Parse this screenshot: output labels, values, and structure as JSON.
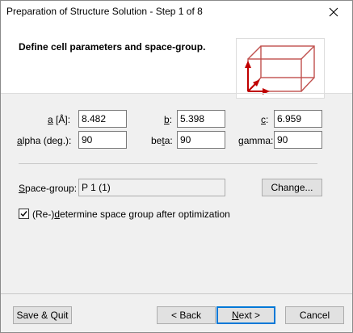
{
  "window": {
    "title": "Preparation of Structure Solution - Step 1 of 8"
  },
  "header": {
    "heading": "Define cell parameters and space-group."
  },
  "cell": {
    "a": {
      "label_key": "a",
      "label_rest": " [Å]:",
      "value": "8.482"
    },
    "b": {
      "label_key": "b",
      "label_rest": ":",
      "value": "5.398"
    },
    "c": {
      "label_key": "c",
      "label_rest": ":",
      "value": "6.959"
    },
    "alpha": {
      "label_key": "a",
      "label_rest": "lpha (deg.):",
      "value": "90"
    },
    "beta": {
      "label_pre": "be",
      "label_key": "t",
      "label_rest": "a:",
      "value": "90"
    },
    "gamma": {
      "label_key": "g",
      "label_rest": "amma:",
      "value": "90"
    }
  },
  "spacegroup": {
    "label_key": "S",
    "label_rest": "pace-group:",
    "value": "P 1 (1)",
    "change_pre": "Chan",
    "change_key": "g",
    "change_rest": "e...",
    "redetermine_pre": "(Re-)",
    "redetermine_key": "d",
    "redetermine_rest": "etermine space group after optimization",
    "redetermine_checked": true
  },
  "buttons": {
    "save_quit": "Save & Quit",
    "back": "< Back",
    "next_pre": "",
    "next_key": "N",
    "next_rest": "ext >",
    "cancel": "Cancel"
  },
  "colors": {
    "cell_box": "#c0504d",
    "cell_arrow": "#c00000",
    "focus": "#0078d7"
  },
  "icons": {
    "close": "close-icon",
    "cell": "unit-cell-icon",
    "check": "checkmark-icon"
  }
}
